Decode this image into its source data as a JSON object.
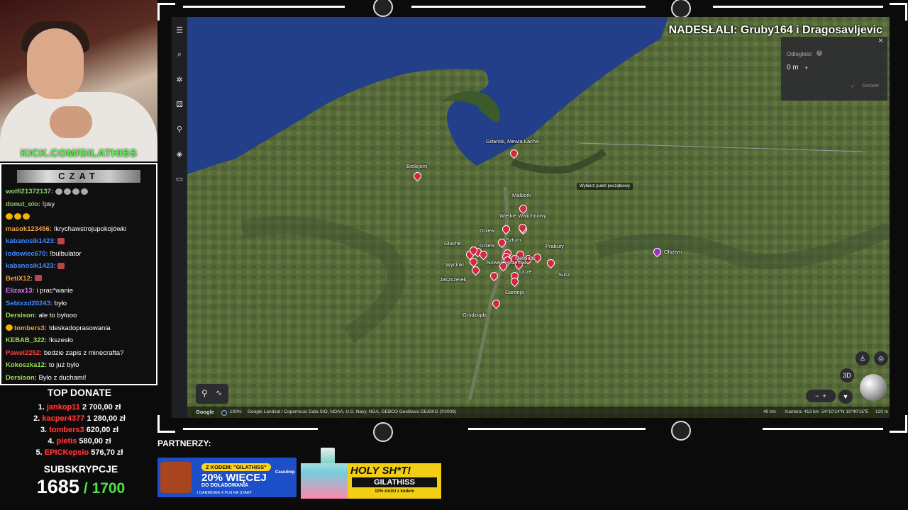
{
  "stream": {
    "kick_url": "KICK.COM/GILATHISS",
    "chat_title": "CZAT",
    "chat": [
      {
        "user": "wolfi21372137:",
        "text": "",
        "color": "#8fd26a",
        "emotes": 4
      },
      {
        "user": "donut_olo:",
        "text": "!psy",
        "color": "#8fd26a"
      },
      {
        "user": "",
        "text": "",
        "color": "#ffffff",
        "badges_only": true
      },
      {
        "user": "masok123456:",
        "text": "!krychawstrojupokojówki",
        "color": "#f0a040"
      },
      {
        "user": "kabanosik1423:",
        "text": "",
        "color": "#3f8cff",
        "emotes": 1
      },
      {
        "user": "lodowiec670:",
        "text": "!bulbulator",
        "color": "#3f8cff"
      },
      {
        "user": "kabanosik1423:",
        "text": "",
        "color": "#3f8cff",
        "emotes": 1
      },
      {
        "user": "BetiX12:",
        "text": "",
        "color": "#f0a040",
        "emotes": 1
      },
      {
        "user": "Elizax13:",
        "text": "i prac*wanie",
        "color": "#d77cf0"
      },
      {
        "user": "Sebixxd20243:",
        "text": "było",
        "color": "#3f8cff"
      },
      {
        "user": "Dersison:",
        "text": "ale to byłooo",
        "color": "#9be04f"
      },
      {
        "user": "tombers3:",
        "text": "!deskadoprasowania",
        "color": "#f0a040"
      },
      {
        "user": "KEBAB_322:",
        "text": "!kszesło",
        "color": "#9be04f"
      },
      {
        "user": "Pawel2252:",
        "text": "bedzie zapis z minecrafta?",
        "color": "#ff4040"
      },
      {
        "user": "Kokoszka12:",
        "text": "to już było",
        "color": "#9be04f"
      },
      {
        "user": "Dersison:",
        "text": "Było z duchami!",
        "color": "#9be04f"
      }
    ],
    "top_donate_title": "TOP DONATE",
    "top_donate": [
      {
        "rank": "1.",
        "name": "jankop11",
        "amount": "2 700,00 zł"
      },
      {
        "rank": "2.",
        "name": "kacper4377",
        "amount": "1 280,00 zł"
      },
      {
        "rank": "3.",
        "name": "tombers3",
        "amount": "620,00 zł"
      },
      {
        "rank": "4.",
        "name": "pietis",
        "amount": "580,00 zł"
      },
      {
        "rank": "5.",
        "name": "EPICKepsio",
        "amount": "576,70 zł"
      }
    ],
    "subs_title": "SUBSKRYPCJE",
    "subs_current": "1685",
    "subs_goal": "/ 1700",
    "partners_label": "PARTNERZY:",
    "ad1": {
      "code": "Z KODEM: \"GILATHISS\"",
      "brand": "Casedrop",
      "headline": "20% WIĘCEJ",
      "sub": "DO DOŁADOWANIA",
      "small": "I DARMOWE 4 PLN NA START"
    },
    "ad2": {
      "headline": "HOLY SH*T!",
      "code": "GILATHISS",
      "small": "10% zniżki z kodem"
    }
  },
  "map": {
    "caption": "NADESŁALI: Gruby164 i Dragosavljevic",
    "measure": {
      "label": "Odległość",
      "value": "0 m",
      "done": "Gotowe"
    },
    "tooltip": "Wybierz punkt początkowy",
    "places": [
      {
        "name": "Gdańsk, Mewia Łacha",
        "pin": true
      },
      {
        "name": "Betlejem",
        "pin": true
      },
      {
        "name": "Malbork",
        "pin": true
      },
      {
        "name": "Wielkie Walichnowy",
        "pin": true
      },
      {
        "name": "Gniew",
        "pin": true
      },
      {
        "name": "Sztum",
        "pin": true
      },
      {
        "name": "Głuche",
        "pin": true
      },
      {
        "name": "Gniew",
        "pin": true
      },
      {
        "name": "Prabuty",
        "pin": false
      },
      {
        "name": "Nowe",
        "pin": true
      },
      {
        "name": "Rożental",
        "pin": true
      },
      {
        "name": "Mikołajki",
        "pin": true
      },
      {
        "name": "Wycinki",
        "pin": true
      },
      {
        "name": "Licze",
        "pin": true
      },
      {
        "name": "Susz",
        "pin": true
      },
      {
        "name": "Jaszczerek",
        "pin": true
      },
      {
        "name": "Gardeja",
        "pin": true
      },
      {
        "name": "Grudziądz",
        "pin": true
      },
      {
        "name": "Olsztyn",
        "pin": true,
        "color": "purple"
      }
    ],
    "bottom": {
      "google": "Google",
      "zoom": "100%",
      "credits": "Google   Landsat / Copernicus   Data SIO, NOAA, U.S. Navy, NGA, GEBCO   GeoBasis-DE/BKG (©2009)",
      "scale": "40 km",
      "camera": "Kamera: 413 km",
      "coords": "54°10'14\"N 19°40'15\"E",
      "alt": "120 m"
    },
    "view_3d": "3D"
  }
}
